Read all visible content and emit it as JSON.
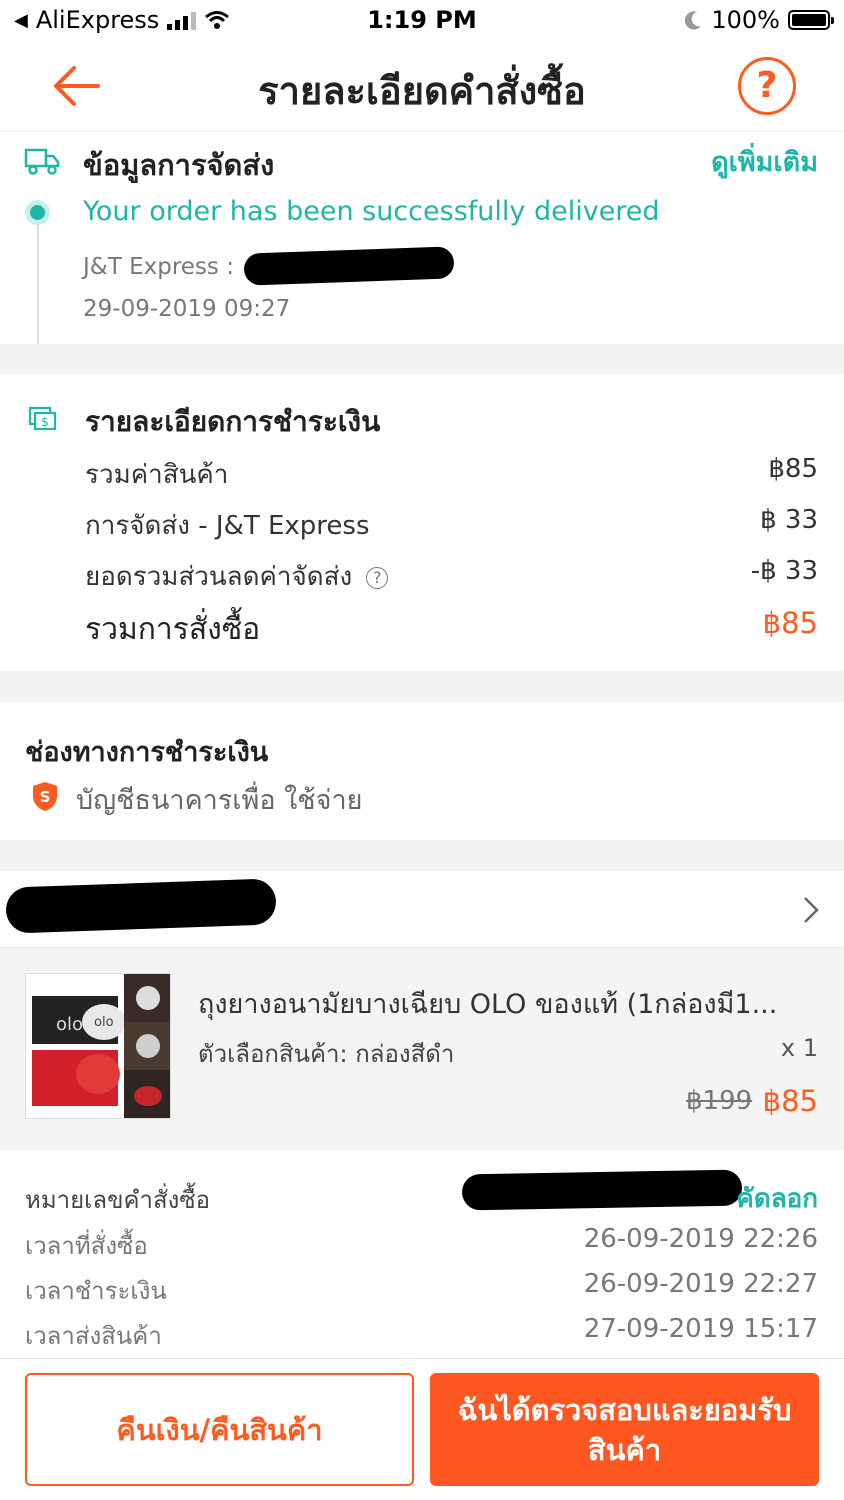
{
  "status_bar": {
    "carrier": "AliExpress",
    "time": "1:19 PM",
    "battery": "100%"
  },
  "header": {
    "title": "รายละเอียดคำสั่งซื้อ",
    "help": "?"
  },
  "shipping": {
    "title": "ข้อมูลการจัดส่ง",
    "more_link": "ดูเพิ่มเติม",
    "status": "Your order has been successfully delivered",
    "carrier_label": "J&T Express :",
    "timestamp": "29-09-2019 09:27"
  },
  "payment": {
    "title": "รายละเอียดการชำระเงิน",
    "rows": [
      {
        "label": "รวมค่าสินค้า",
        "value": "฿85"
      },
      {
        "label": "การจัดส่ง - J&T Express",
        "value": "฿ 33"
      },
      {
        "label": "ยอดรวมส่วนลดค่าจัดส่ง",
        "value": "-฿ 33"
      }
    ],
    "total_label": "รวมการสั่งซื้อ",
    "total_value": "฿85"
  },
  "payment_method": {
    "title": "ช่องทางการชำระเงิน",
    "method": "บัญชีธนาคารเพื่อ ใช้จ่าย"
  },
  "product": {
    "name": "ถุงยางอนามัยบางเฉียบ OLO ของแท้ (1กล่องมี1...",
    "variant": "ตัวเลือกสินค้า: กล่องสีดำ",
    "quantity": "x 1",
    "original_price": "฿199",
    "price": "฿85",
    "thumb_brand": "olo"
  },
  "order_info": {
    "rows": [
      {
        "label": "หมายเลขคำสั่งซื้อ",
        "value": "คัดลอก"
      },
      {
        "label": "เวลาที่สั่งซื้อ",
        "value": "26-09-2019 22:26"
      },
      {
        "label": "เวลาชำระเงิน",
        "value": "26-09-2019 22:27"
      },
      {
        "label": "เวลาส่งสินค้า",
        "value": "27-09-2019 15:17"
      }
    ]
  },
  "footer": {
    "refund_label": "คืนเงิน/คืนสินค้า",
    "confirm_label": "ฉันได้ตรวจสอบและยอมรับสินค้า"
  },
  "colors": {
    "accent": "#ff5a1f",
    "teal": "#1fb6a8"
  }
}
